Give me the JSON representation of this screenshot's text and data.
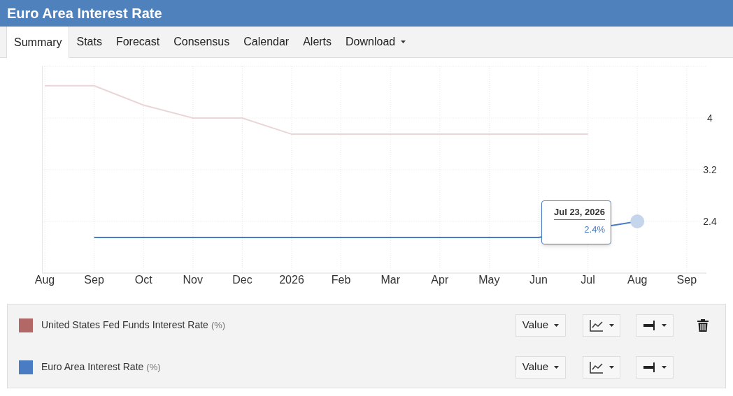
{
  "window": {
    "title": "Euro Area Interest Rate"
  },
  "tabs": [
    {
      "label": "Summary",
      "selected": true,
      "kind": "tab"
    },
    {
      "label": "Stats",
      "selected": false,
      "kind": "tab"
    },
    {
      "label": "Forecast",
      "selected": false,
      "kind": "tab"
    },
    {
      "label": "Consensus",
      "selected": false,
      "kind": "tab"
    },
    {
      "label": "Calendar",
      "selected": false,
      "kind": "tab"
    },
    {
      "label": "Alerts",
      "selected": false,
      "kind": "tab"
    },
    {
      "label": "Download",
      "selected": false,
      "kind": "dropdown"
    }
  ],
  "chart": {
    "chart_data": {
      "type": "line",
      "categories": [
        "Aug",
        "Sep",
        "Oct",
        "Nov",
        "Dec",
        "2026",
        "Feb",
        "Mar",
        "Apr",
        "May",
        "Jun",
        "Jul",
        "Aug",
        "Sep"
      ],
      "series": [
        {
          "name": "United States Fed Funds Interest Rate",
          "color": "#ead6d6",
          "values": [
            4.5,
            4.5,
            4.2,
            4.0,
            4.0,
            3.75,
            3.75,
            3.75,
            3.75,
            3.75,
            3.75,
            3.75,
            null,
            null
          ]
        },
        {
          "name": "Euro Area Interest Rate",
          "color": "#4a7cc4",
          "values": [
            null,
            2.15,
            2.15,
            2.15,
            2.15,
            2.15,
            2.15,
            2.15,
            2.15,
            2.15,
            2.15,
            null,
            2.4,
            null
          ]
        }
      ],
      "grid": true,
      "ylim": [
        1.6,
        4.8
      ],
      "yticks": [
        {
          "value": 2.4,
          "label": "2.4"
        },
        {
          "value": 3.2,
          "label": "3.2"
        },
        {
          "value": 4,
          "label": "4"
        }
      ]
    },
    "tooltip": {
      "date": "Jul 23, 2026",
      "value": "2.4%"
    }
  },
  "legend": [
    {
      "unit": "(%)",
      "color": "#b36868",
      "mode": "Value",
      "removable": true
    },
    {
      "unit": "(%)",
      "color": "#4a7cc4",
      "mode": "Value",
      "removable": false
    }
  ]
}
